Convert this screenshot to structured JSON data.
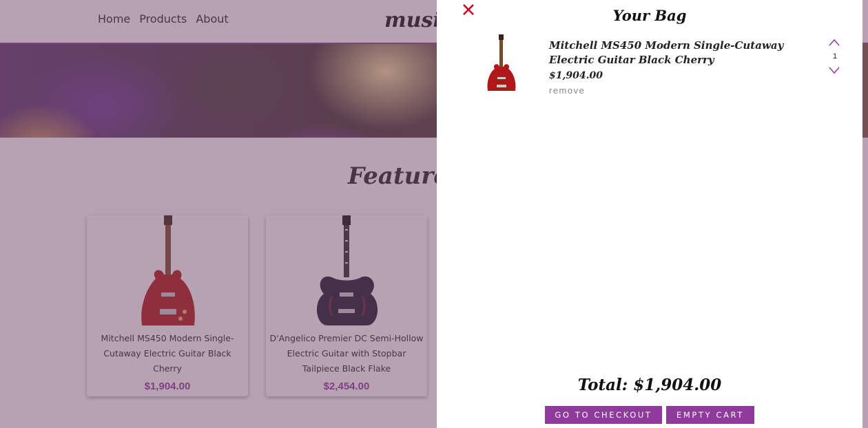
{
  "nav": {
    "links": [
      "Home",
      "Products",
      "About"
    ],
    "brand": "music"
  },
  "featured": {
    "title": "Featured",
    "products": [
      {
        "name": "Mitchell MS450 Modern Single-Cutaway Electric Guitar Black Cherry",
        "price": "$1,904.00",
        "image_icon": "red-electric-guitar"
      },
      {
        "name": "D'Angelico Premier DC Semi-Hollow Electric Guitar with Stopbar Tailpiece Black Flake",
        "price": "$2,454.00",
        "image_icon": "black-semi-hollow-guitar"
      }
    ]
  },
  "cart": {
    "title": "Your Bag",
    "items": [
      {
        "name": "Mitchell MS450 Modern Single-Cutaway Electric Guitar Black Cherry",
        "price": "$1,904.00",
        "remove_label": "remove",
        "quantity": "1",
        "image_icon": "red-electric-guitar"
      }
    ],
    "total": "Total: $1,904.00",
    "checkout_label": "GO TO CHECKOUT",
    "empty_label": "EMPTY CART"
  },
  "colors": {
    "accent": "#8e3b9c",
    "close": "#d0021b"
  }
}
